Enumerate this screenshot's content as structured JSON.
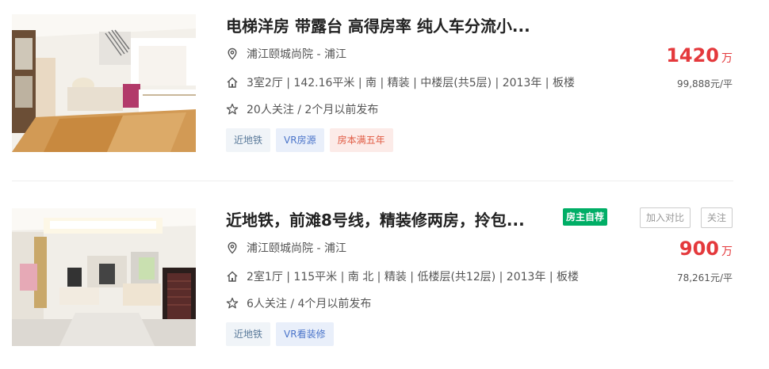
{
  "listings": [
    {
      "title": "电梯洋房 带露台 高得房率 纯人车分流小...",
      "location": "浦江颐城尚院 - 浦江",
      "info": "3室2厅 | 142.16平米 | 南 | 精装 | 中楼层(共5层) | 2013年 | 板楼",
      "follow": "20人关注 / 2个月以前发布",
      "tags": [
        "近地铁",
        "VR房源",
        "房本满五年"
      ],
      "total_price": "1420",
      "price_unit": "万",
      "unit_price": "99,888元/平"
    },
    {
      "title": "近地铁，前滩8号线，精装修两房，拎包...",
      "badge": "房主自荐",
      "location": "浦江颐城尚院 - 浦江",
      "info": "2室1厅 | 115平米 | 南 北 | 精装 | 低楼层(共12层) | 2013年 | 板楼",
      "follow": "6人关注 / 4个月以前发布",
      "tags": [
        "近地铁",
        "VR看装修"
      ],
      "total_price": "900",
      "price_unit": "万",
      "unit_price": "78,261元/平",
      "buttons": {
        "compare": "加入对比",
        "follow": "关注"
      }
    }
  ],
  "colors": {
    "price": "#e4393c",
    "badge": "#00ae66"
  },
  "icons": {
    "location": "location-pin-icon",
    "house": "house-icon",
    "star": "star-icon"
  }
}
